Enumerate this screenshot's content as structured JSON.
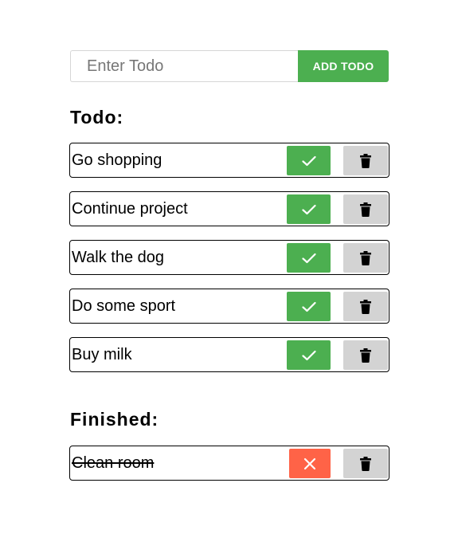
{
  "add_form": {
    "placeholder": "Enter Todo",
    "value": "",
    "button_label": "ADD TODO"
  },
  "todo": {
    "heading": "Todo:",
    "items": [
      {
        "text": "Go shopping"
      },
      {
        "text": "Continue project"
      },
      {
        "text": "Walk the dog"
      },
      {
        "text": "Do some sport"
      },
      {
        "text": "Buy milk"
      }
    ],
    "complete_icon": "check-icon",
    "delete_icon": "trash-icon"
  },
  "finished": {
    "heading": "Finished:",
    "items": [
      {
        "text": "Clean room"
      }
    ],
    "undo_icon": "x-icon",
    "delete_icon": "trash-icon"
  },
  "colors": {
    "accent_green": "#4caf50",
    "undo_red": "#ff6347",
    "delete_gray": "#d3d3d3"
  }
}
